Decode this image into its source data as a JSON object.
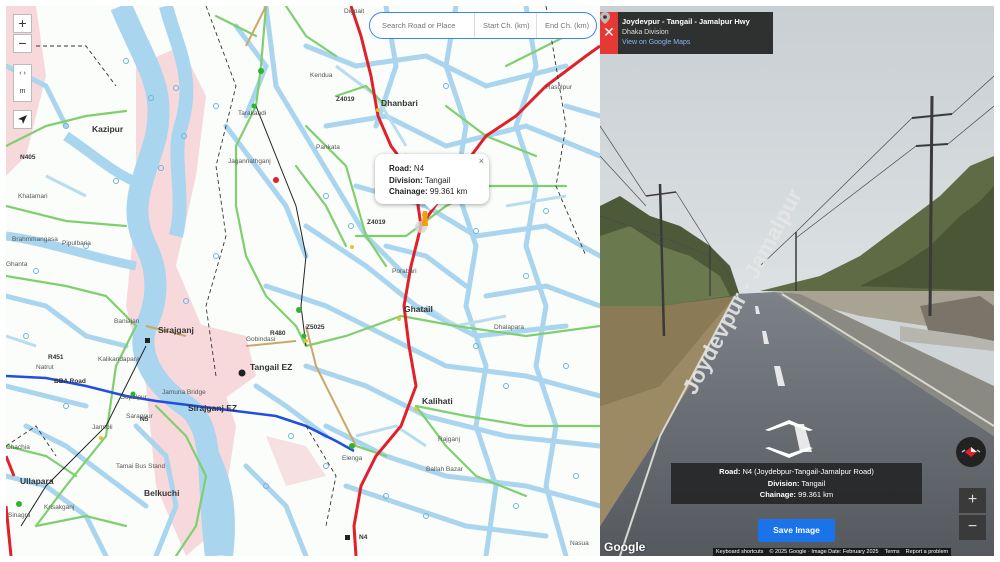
{
  "search": {
    "road_placeholder": "Search Road or Place",
    "start_placeholder": "Start Ch. (km)",
    "end_placeholder": "End Ch. (km)"
  },
  "map_controls": {
    "zoom_in": "+",
    "zoom_out": "−",
    "scale_top": "‹ ›",
    "scale_unit": "m"
  },
  "map_labels": {
    "towns": [
      "Kazipur",
      "Dhanbari",
      "Ghatail",
      "Sirajganj",
      "Tangail EZ",
      "Kalihati",
      "Ullapara",
      "Belkuchi",
      "Sirajganj EZ"
    ],
    "places": [
      "Digpait",
      "Kendua",
      "Tarakandi",
      "Jagannathganj",
      "Pankata",
      "Rasulpur",
      "Khatamari",
      "Brahmmangasa",
      "Pipulbaria",
      "Porabari",
      "Gobindasi",
      "Dhalapara",
      "Baniajan",
      "Kalikandapara",
      "Jamuna Bridge",
      "Natrut",
      "Gopalpur",
      "Jamtoli",
      "Elenga",
      "Ballah Bazar",
      "Tamai Bus Stand",
      "Krisakganj",
      "Sinagra",
      "Nasua",
      "Chachia",
      "Ghanta",
      "Rajganj",
      "Sarappur"
    ],
    "roads": [
      "Z4019",
      "Z4019",
      "R480",
      "Z5025",
      "N405",
      "R451",
      "BBA Road",
      "N4",
      "N5"
    ]
  },
  "popup": {
    "road_label": "Road:",
    "road_value": "N4",
    "division_label": "Division:",
    "division_value": "Tangail",
    "chainage_label": "Chainage:",
    "chainage_value": "99.361 km",
    "close": "×"
  },
  "streetview": {
    "title": "Joydevpur - Tangail - Jamalpur Hwy",
    "subtitle": "Dhaka Division",
    "link": "View on Google Maps",
    "road_markings": "Joydevpur - Jamalpur",
    "info_road_label": "Road:",
    "info_road_value": "N4 (Joydebpur-Tangail-Jamalpur Road)",
    "info_division_label": "Division:",
    "info_division_value": "Tangail",
    "info_chainage_label": "Chainage:",
    "info_chainage_value": "99.361 km",
    "save_button": "Save Image",
    "zoom_in": "+",
    "zoom_out": "−",
    "google_logo": "Google",
    "attribution": [
      "Keyboard shortcuts",
      "© 2025 Google · Image Date: February 2025",
      "Terms",
      "Report a problem"
    ]
  },
  "colors": {
    "river": "#a9d5ee",
    "highway": "#e0202a",
    "bridge_road": "#1f4fe0",
    "accent": "#1a73e8"
  }
}
